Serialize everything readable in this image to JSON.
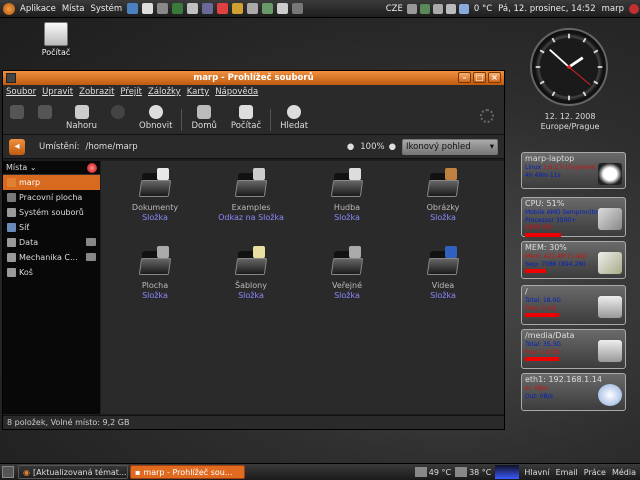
{
  "top_panel": {
    "menus": [
      "Aplikace",
      "Místa",
      "Systém"
    ],
    "keyboard_layout": "CZE",
    "weather": "0 °C",
    "datetime": "Pá, 12. prosinec, 14:52",
    "user": "marp"
  },
  "desktop": {
    "computer_icon_label": "Počítač"
  },
  "clock": {
    "hour_angle": 56,
    "minute_angle": 312,
    "second_angle": 130,
    "date_line1": "12. 12. 2008",
    "date_line2": "Europe/Prague"
  },
  "conky": {
    "host": {
      "title": "marp-laptop",
      "line1_a": "Linux",
      "line1_b": "2.6.27-10-generic",
      "line2": "4h 49m 11s"
    },
    "cpu": {
      "title": "CPU:",
      "percent": "51%",
      "line1": "Mobile AMD Sempron(tm)",
      "line2": "Processor 3500+",
      "line3": "1800.0M",
      "bar": 0.51
    },
    "mem": {
      "title": "MEM:",
      "percent": "30%",
      "line1": "Mem: 421.4M (1.4G)",
      "line2": "Swp: 708K (894.2M)",
      "bar": 0.3
    },
    "root": {
      "title": "/",
      "total": "Total: 18.0G",
      "free": "Free: 9.2G",
      "bar": 0.49
    },
    "data": {
      "title": "/media/Data",
      "total": "Total: 35.3G",
      "free": "Free: 18.0G",
      "bar": 0.49
    },
    "net": {
      "title": "eth1:",
      "ip": "192.168.1.14",
      "in": "In:  0B/s",
      "out": "Out: 0B/s"
    }
  },
  "window": {
    "title": "marp - Prohlížeč souborů",
    "menu": [
      "Soubor",
      "Upravit",
      "Zobrazit",
      "Přejít",
      "Záložky",
      "Karty",
      "Nápověda"
    ],
    "toolbar": {
      "up": "Nahoru",
      "reload": "Obnovit",
      "home": "Domů",
      "computer": "Počítač",
      "search": "Hledat"
    },
    "location_label": "Umístění:",
    "location_path": "/home/marp",
    "zoom": "100%",
    "view_mode": "Ikonový pohled",
    "sidebar_header": "Místa",
    "sidebar_items": [
      {
        "label": "marp",
        "color": "#e08030"
      },
      {
        "label": "Pracovní plocha",
        "color": "#7a7a7a"
      },
      {
        "label": "Systém souborů",
        "color": "#9a9a9a"
      },
      {
        "label": "Síť",
        "color": "#6a8abc"
      },
      {
        "label": "Data",
        "color": "#9a9a9a"
      },
      {
        "label": "Mechanika C...",
        "color": "#9a9a9a"
      },
      {
        "label": "Koš",
        "color": "#9a9a9a"
      }
    ],
    "files": [
      {
        "name": "Dokumenty",
        "type": "Složka",
        "emblem": "#e8e8e8"
      },
      {
        "name": "Examples",
        "type": "Odkaz na Složka",
        "emblem": "#cccccc"
      },
      {
        "name": "Hudba",
        "type": "Složka",
        "emblem": "#dddddd"
      },
      {
        "name": "Obrázky",
        "type": "Složka",
        "emblem": "#c08040"
      },
      {
        "name": "Plocha",
        "type": "Složka",
        "emblem": "#aaaaaa"
      },
      {
        "name": "Šablony",
        "type": "Složka",
        "emblem": "#e8e0a0"
      },
      {
        "name": "Veřejné",
        "type": "Složka",
        "emblem": "#aaaaaa"
      },
      {
        "name": "Videa",
        "type": "Složka",
        "emblem": "#3060c0"
      }
    ],
    "status": "8 položek, Volné místo: 9,2 GB"
  },
  "bottom_panel": {
    "tasks": [
      "[Aktualizovaná témat...",
      "marp - Prohlížeč sou..."
    ],
    "temp1": "49 °C",
    "temp2": "38 °C",
    "workspaces": [
      "Hlavní",
      "Email",
      "Práce",
      "Média"
    ]
  },
  "colors": {
    "accent": "#e06a20",
    "link": "#8a8aff"
  }
}
